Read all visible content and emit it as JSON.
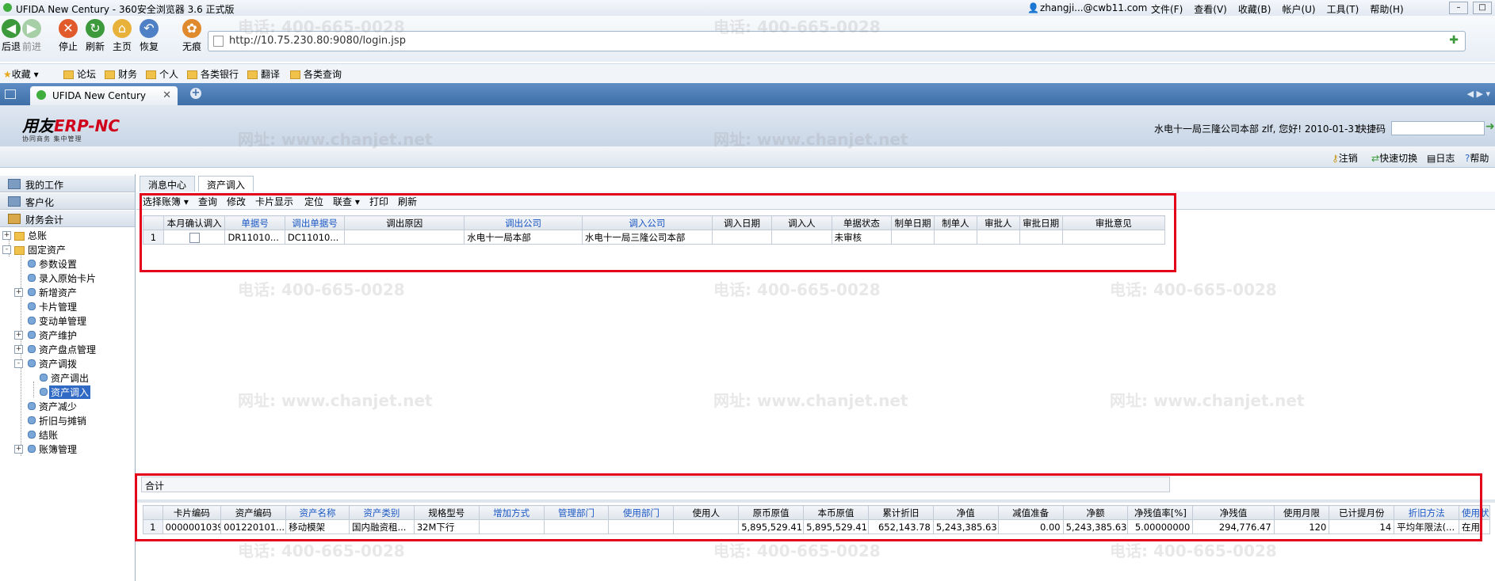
{
  "browser": {
    "title": "UFIDA New Century - 360安全浏览器 3.6 正式版",
    "user": "zhangji...@cwb11.com",
    "menu": [
      "文件(F)",
      "查看(V)",
      "收藏(B)",
      "帐户(U)",
      "工具(T)",
      "帮助(H)"
    ],
    "nav": [
      {
        "label": "后退",
        "icon": "back-arrow-icon"
      },
      {
        "label": "前进",
        "icon": "forward-arrow-icon"
      },
      {
        "label": "停止",
        "icon": "stop-icon"
      },
      {
        "label": "刷新",
        "icon": "refresh-icon"
      },
      {
        "label": "主页",
        "icon": "home-icon"
      },
      {
        "label": "恢复",
        "icon": "undo-icon"
      },
      {
        "label": "无痕",
        "icon": "paw-icon"
      }
    ],
    "url": "http://10.75.230.80:9080/login.jsp",
    "favorites": [
      "收藏",
      "论坛",
      "财务",
      "个人",
      "各类银行",
      "翻译",
      "各类查询"
    ],
    "tab": "UFIDA New Century"
  },
  "app": {
    "logo": {
      "text_black": "用友",
      "text_red": "ERP-",
      "text_tail": "NC",
      "tagline": "协同商务  集中管理"
    },
    "header_info": "水电十一局三隆公司本部 zlf, 您好! 2010-01-31",
    "quick_code_label": "快捷码",
    "toolstrip": [
      "注销",
      "快速切换",
      "日志",
      "帮助"
    ]
  },
  "left": {
    "headers": [
      "我的工作",
      "客户化",
      "财务会计"
    ],
    "tree": [
      {
        "label": "总账",
        "level": 1,
        "type": "folder",
        "expander": "+"
      },
      {
        "label": "固定资产",
        "level": 1,
        "type": "folder",
        "expander": "-"
      },
      {
        "label": "参数设置",
        "level": 2,
        "type": "leaf"
      },
      {
        "label": "录入原始卡片",
        "level": 2,
        "type": "leaf"
      },
      {
        "label": "新增资产",
        "level": 2,
        "type": "node",
        "expander": "+"
      },
      {
        "label": "卡片管理",
        "level": 2,
        "type": "leaf"
      },
      {
        "label": "变动单管理",
        "level": 2,
        "type": "leaf"
      },
      {
        "label": "资产维护",
        "level": 2,
        "type": "node",
        "expander": "+"
      },
      {
        "label": "资产盘点管理",
        "level": 2,
        "type": "node",
        "expander": "+"
      },
      {
        "label": "资产调拨",
        "level": 2,
        "type": "node",
        "expander": "-"
      },
      {
        "label": "资产调出",
        "level": 3,
        "type": "leaf"
      },
      {
        "label": "资产调入",
        "level": 3,
        "type": "leaf",
        "selected": true
      },
      {
        "label": "资产减少",
        "level": 2,
        "type": "leaf"
      },
      {
        "label": "折旧与摊销",
        "level": 2,
        "type": "leaf"
      },
      {
        "label": "结账",
        "level": 2,
        "type": "leaf"
      },
      {
        "label": "账簿管理",
        "level": 2,
        "type": "node",
        "expander": "+"
      }
    ]
  },
  "main": {
    "tabs": [
      "消息中心",
      "资产调入"
    ],
    "commands": [
      "选择账簿",
      "查询",
      "修改",
      "卡片显示",
      "定位",
      "联查",
      "打印",
      "刷新"
    ],
    "upper_table": {
      "headers": [
        "本月确认调入",
        "单据号",
        "调出单据号",
        "调出原因",
        "调出公司",
        "调入公司",
        "调入日期",
        "调入人",
        "单据状态",
        "制单日期",
        "制单人",
        "审批人",
        "审批日期",
        "审批意见"
      ],
      "rows": [
        [
          "1",
          "",
          "DR11010...",
          "DC11010...",
          "",
          "水电十一局本部",
          "水电十一局三隆公司本部",
          "",
          "",
          "未审核",
          "",
          "",
          "",
          "",
          ""
        ]
      ]
    },
    "sum_label": "合计",
    "lower_table": {
      "headers": [
        "卡片编码",
        "资产编码",
        "资产名称",
        "资产类别",
        "规格型号",
        "增加方式",
        "管理部门",
        "使用部门",
        "使用人",
        "原币原值",
        "本币原值",
        "累计折旧",
        "净值",
        "减值准备",
        "净额",
        "净残值率[%]",
        "净残值",
        "使用月限",
        "已计提月份",
        "折旧方法",
        "使用状"
      ],
      "rows": [
        [
          "1",
          "0000001039",
          "001220101...",
          "移动模架",
          "国内融资租...",
          "32M下行",
          "",
          "",
          "",
          "",
          "5,895,529.41",
          "5,895,529.41",
          "652,143.78",
          "5,243,385.63",
          "0.00",
          "5,243,385.63",
          "5.00000000",
          "294,776.47",
          "120",
          "14",
          "平均年限法(...",
          "在用"
        ]
      ]
    },
    "watermark_phone": "电话: 400-665-0028",
    "watermark_url": "网址: www.chanjet.net"
  }
}
